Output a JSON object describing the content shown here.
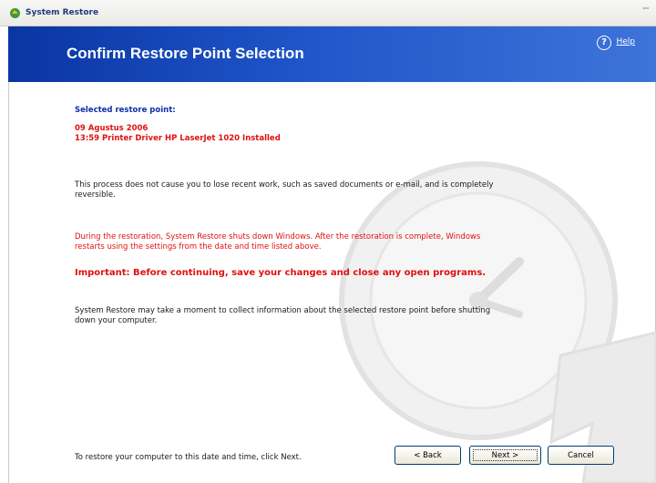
{
  "window": {
    "title": "System Restore",
    "sysmenu": "ꟷ"
  },
  "banner": {
    "title": "Confirm Restore Point Selection",
    "help_label": "Help",
    "help_glyph": "?"
  },
  "selection": {
    "label": "Selected restore point:",
    "date": "09 Agustus 2006",
    "description": "13:59 Printer Driver HP LaserJet 1020 Installed"
  },
  "body": {
    "para1": "This process does not cause you to lose recent work, such as saved documents or e-mail, and is completely reversible.",
    "para2": "During the restoration, System Restore shuts down Windows. After the restoration is complete, Windows restarts using the settings from the date and time listed above.",
    "important": "Important: Before continuing, save your changes and close any open programs.",
    "para3": "System Restore may take a moment to collect information about the selected restore point before shutting down your computer."
  },
  "footer": {
    "instruction": "To restore your computer to this date and time, click Next.",
    "back_label": "< Back",
    "next_label": "Next >",
    "cancel_label": "Cancel"
  },
  "colors": {
    "banner": "#1f55c8",
    "accent_red": "#e01010",
    "label_blue": "#0b2fa8"
  }
}
